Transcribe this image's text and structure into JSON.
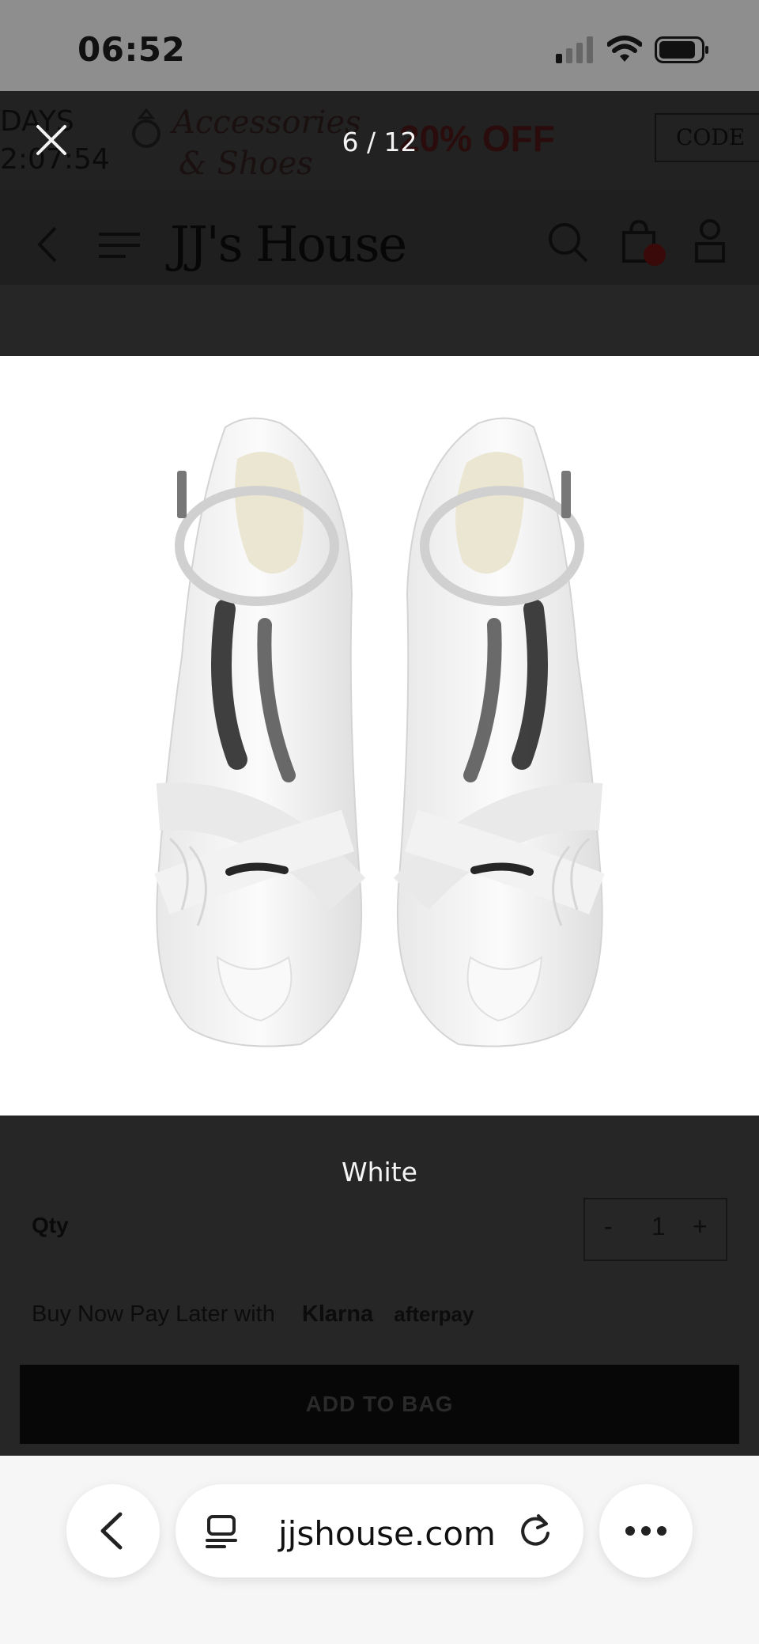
{
  "status_bar": {
    "time": "06:52"
  },
  "background_page": {
    "promo": {
      "days_label": "DAYS",
      "countdown": "2:07:54",
      "accessories_line1": "Accessories",
      "accessories_line2": "& Shoes",
      "discount": "20% OFF",
      "code_label": "CODE"
    },
    "header": {
      "logo": "JJ's House"
    },
    "qty": {
      "label": "Qty",
      "minus": "-",
      "value": "1",
      "plus": "+"
    },
    "bnpl": {
      "text": "Buy Now Pay Later with",
      "klarna": "Klarna",
      "afterpay": "afterpay"
    },
    "add_to_bag": "ADD TO BAG"
  },
  "gallery": {
    "counter": "6 / 12",
    "color_name": "White"
  },
  "browser": {
    "url": "jjshouse.com"
  },
  "colors": {
    "status_bar": "#8e8e8e",
    "overlay": "#262626",
    "overlay_text": "#f4f4f4",
    "browser_bar": "#f6f6f6"
  }
}
